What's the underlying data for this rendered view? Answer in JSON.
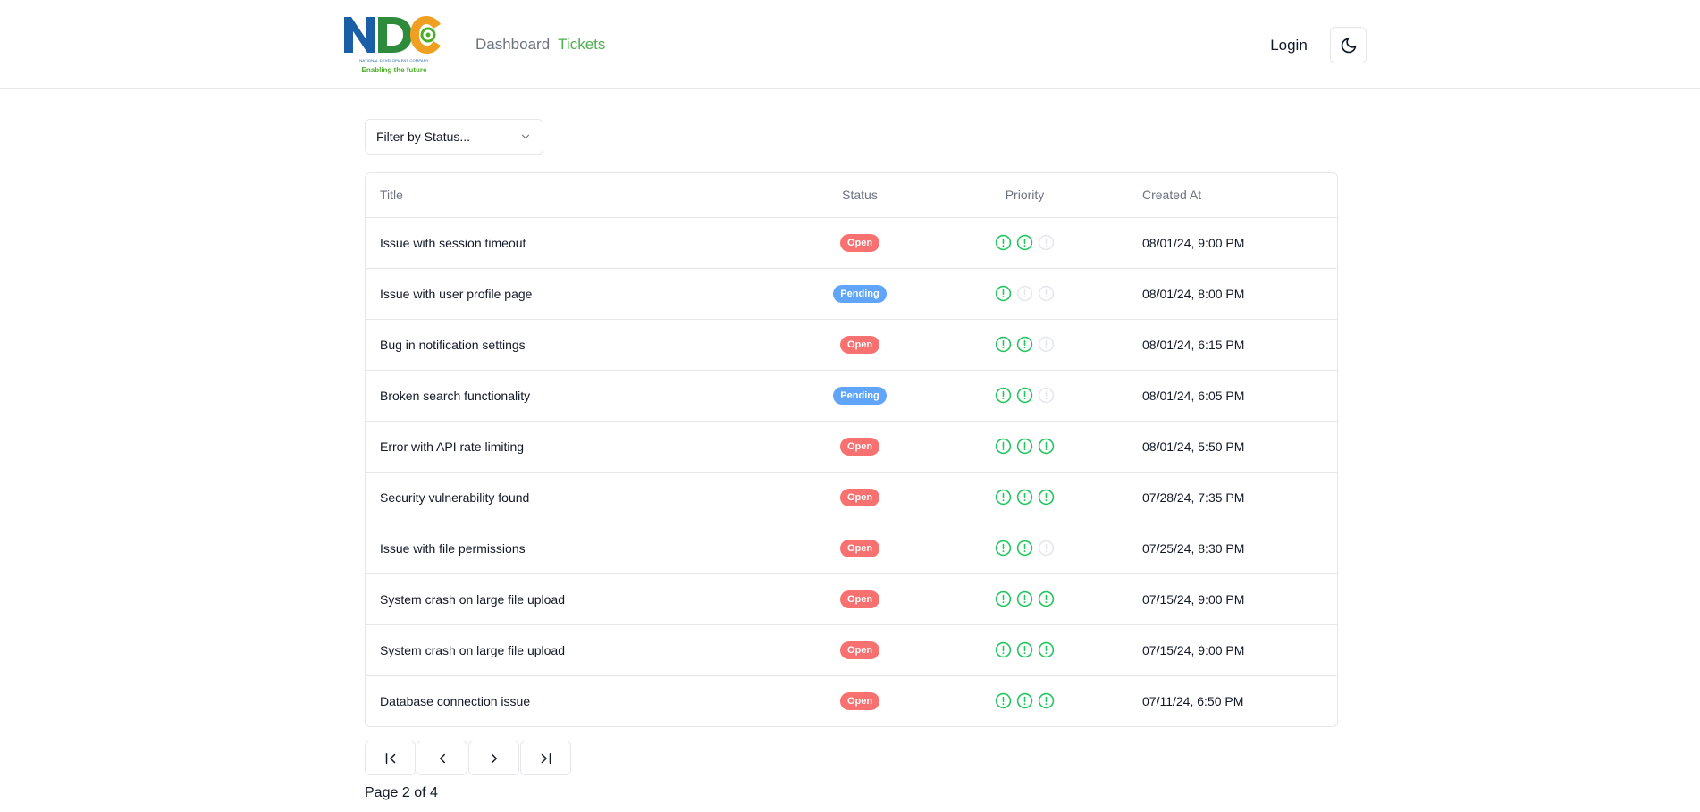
{
  "header": {
    "logo_text": "NDC",
    "logo_fullname": "NATIONAL DEVELOPMENT COMPANY",
    "logo_tagline": "Enabling the future",
    "nav": [
      {
        "label": "Dashboard",
        "active": false
      },
      {
        "label": "Tickets",
        "active": true
      }
    ],
    "login_label": "Login",
    "theme_icon": "moon-icon"
  },
  "filter": {
    "label": "Filter by Status...",
    "icon": "chevron-down-icon"
  },
  "table": {
    "columns": [
      "Title",
      "Status",
      "Priority",
      "Created At"
    ],
    "rows": [
      {
        "title": "Issue with session timeout",
        "status": "Open",
        "priority": 2,
        "created": "08/01/24, 9:00 PM"
      },
      {
        "title": "Issue with user profile page",
        "status": "Pending",
        "priority": 1,
        "created": "08/01/24, 8:00 PM"
      },
      {
        "title": "Bug in notification settings",
        "status": "Open",
        "priority": 2,
        "created": "08/01/24, 6:15 PM"
      },
      {
        "title": "Broken search functionality",
        "status": "Pending",
        "priority": 2,
        "created": "08/01/24, 6:05 PM"
      },
      {
        "title": "Error with API rate limiting",
        "status": "Open",
        "priority": 3,
        "created": "08/01/24, 5:50 PM"
      },
      {
        "title": "Security vulnerability found",
        "status": "Open",
        "priority": 3,
        "created": "07/28/24, 7:35 PM"
      },
      {
        "title": "Issue with file permissions",
        "status": "Open",
        "priority": 2,
        "created": "07/25/24, 8:30 PM"
      },
      {
        "title": "System crash on large file upload",
        "status": "Open",
        "priority": 3,
        "created": "07/15/24, 9:00 PM"
      },
      {
        "title": "System crash on large file upload",
        "status": "Open",
        "priority": 3,
        "created": "07/15/24, 9:00 PM"
      },
      {
        "title": "Database connection issue",
        "status": "Open",
        "priority": 3,
        "created": "07/11/24, 6:50 PM"
      }
    ]
  },
  "pagination": {
    "buttons": [
      {
        "name": "first-page-button",
        "icon": "chevrons-left-bar-icon"
      },
      {
        "name": "prev-page-button",
        "icon": "chevron-left-icon"
      },
      {
        "name": "next-page-button",
        "icon": "chevron-right-icon"
      },
      {
        "name": "last-page-button",
        "icon": "chevrons-right-bar-icon"
      }
    ],
    "page_label": "Page",
    "current": "2",
    "of_label": "of",
    "total": "4"
  },
  "colors": {
    "accent_green": "#4caf50",
    "open_badge": "#f87171",
    "pending_badge": "#60a5fa",
    "priority_active": "#22c55e",
    "priority_inactive": "#e5e7eb"
  }
}
